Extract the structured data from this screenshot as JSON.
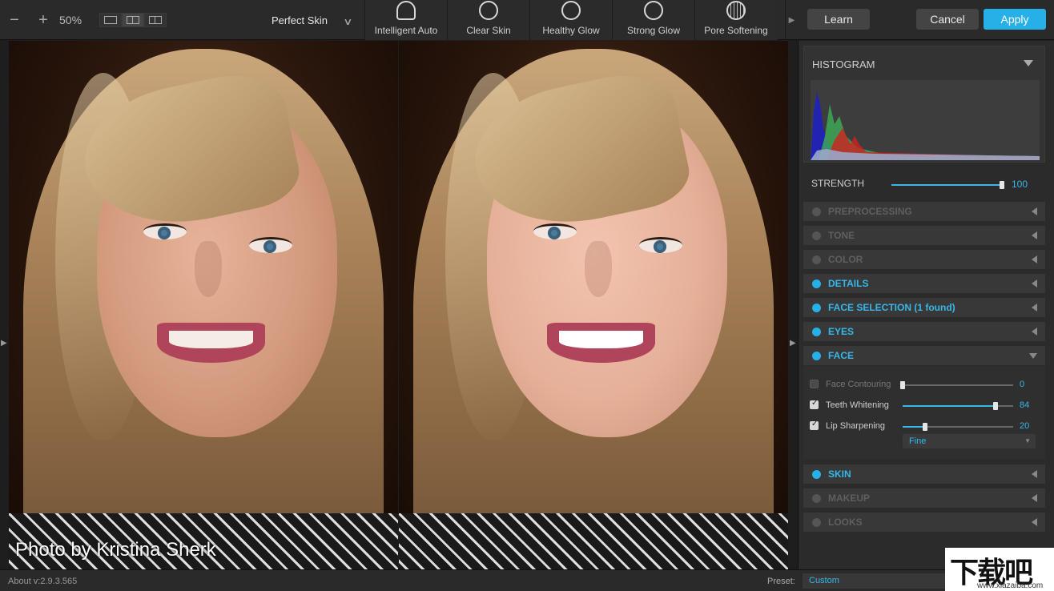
{
  "toolbar": {
    "zoom_out": "−",
    "zoom_in": "+",
    "zoom_level": "50%",
    "preset": "Perfect Skin",
    "looks": [
      {
        "label": "Intelligent Auto",
        "icon": "person-auto-icon"
      },
      {
        "label": "Clear Skin",
        "icon": "face-profile-icon"
      },
      {
        "label": "Healthy Glow",
        "icon": "glow-face-icon"
      },
      {
        "label": "Strong Glow",
        "icon": "strong-glow-face-icon"
      },
      {
        "label": "Pore Softening",
        "icon": "pore-grid-icon"
      }
    ],
    "learn": "Learn",
    "cancel": "Cancel",
    "apply": "Apply",
    "accent": "#27b0e8"
  },
  "photo": {
    "caption": "Photo by Kristina Sherk"
  },
  "panel": {
    "histogram_title": "HISTOGRAM",
    "strength_label": "STRENGTH",
    "strength_value": "100",
    "strength_level": 1.0,
    "sections": [
      {
        "label": "PREPROCESSING",
        "enabled": false
      },
      {
        "label": "TONE",
        "enabled": false
      },
      {
        "label": "COLOR",
        "enabled": false
      },
      {
        "label": "DETAILS",
        "enabled": true
      },
      {
        "label": "FACE SELECTION (1 found)",
        "enabled": true
      },
      {
        "label": "EYES",
        "enabled": true
      },
      {
        "label": "FACE",
        "enabled": true,
        "expanded": true
      },
      {
        "label": "SKIN",
        "enabled": true
      },
      {
        "label": "MAKEUP",
        "enabled": false
      },
      {
        "label": "LOOKS",
        "enabled": false
      }
    ],
    "face_controls": [
      {
        "label": "Face Contouring",
        "checked": false,
        "value": "0",
        "level": 0.0
      },
      {
        "label": "Teeth Whitening",
        "checked": true,
        "value": "84",
        "level": 0.84
      },
      {
        "label": "Lip Sharpening",
        "checked": true,
        "value": "20",
        "level": 0.2
      }
    ],
    "lip_mode": "Fine"
  },
  "status": {
    "about": "About v:2.9.3.565",
    "preset_label": "Preset:",
    "preset_value": "Custom"
  },
  "watermark": {
    "main": "下载吧",
    "sub": "www.xiazaiba.com"
  }
}
